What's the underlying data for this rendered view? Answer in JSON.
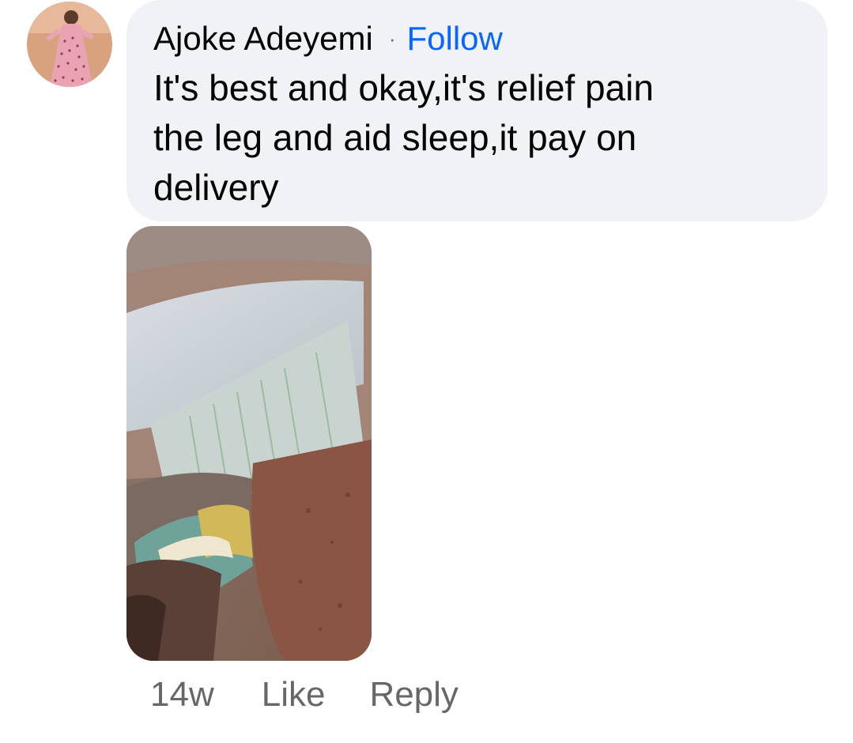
{
  "comment": {
    "author": "Ajoke Adeyemi",
    "separator": "·",
    "follow_label": "Follow",
    "text": "It's best and okay,it's relief pain\nthe leg and aid sleep,it pay on\ndelivery",
    "timestamp": "14w",
    "like_label": "Like",
    "reply_label": "Reply"
  },
  "colors": {
    "bubble_bg": "#f0f2f5",
    "link_blue": "#0866ff",
    "meta_gray": "#65676b",
    "text": "#050505"
  }
}
